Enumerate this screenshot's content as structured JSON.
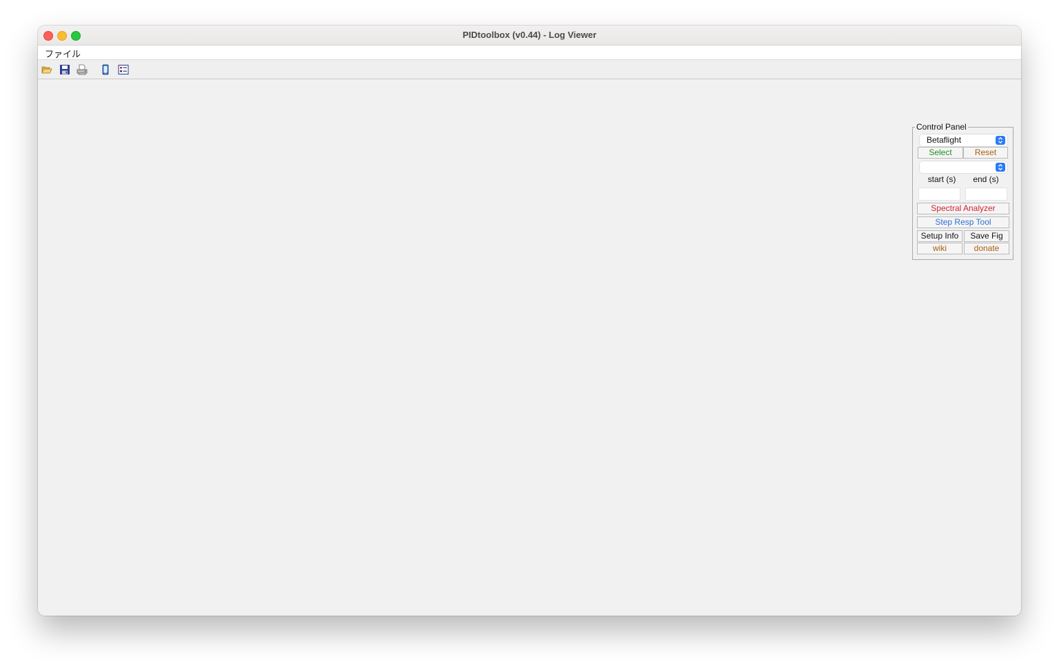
{
  "window": {
    "title": "PIDtoolbox (v0.44) - Log Viewer"
  },
  "menubar": {
    "items": [
      {
        "label": "ファイル"
      }
    ]
  },
  "toolbar": {
    "icons": [
      "open-folder-icon",
      "save-disk-icon",
      "print-icon",
      "phone-device-icon",
      "layout-editor-icon"
    ]
  },
  "control_panel": {
    "title": "Control Panel",
    "firmware_select": {
      "value": "Betaflight"
    },
    "select_label": "Select",
    "reset_label": "Reset",
    "file_select": {
      "value": ""
    },
    "start_label": "start (s)",
    "end_label": "end (s)",
    "start_value": "",
    "end_value": "",
    "spectral_label": "Spectral Analyzer",
    "step_resp_label": "Step Resp Tool",
    "setup_info_label": "Setup Info",
    "save_fig_label": "Save Fig",
    "wiki_label": "wiki",
    "donate_label": "donate",
    "colors": {
      "select": "#1f8f1f",
      "reset": "#a85d0a",
      "spectral": "#d31f2e",
      "step_resp": "#2a6ed1",
      "wiki": "#a85d0a",
      "donate": "#a85d0a",
      "accent": "#2b7cf7"
    }
  }
}
